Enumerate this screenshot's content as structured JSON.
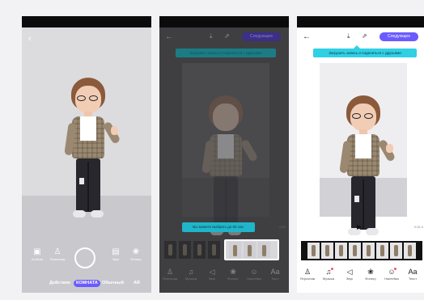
{
  "screen1": {
    "back_icon": "chevron-left-icon",
    "tools": [
      {
        "label": "Альбом",
        "icon": "album-icon"
      },
      {
        "label": "Персонаж",
        "icon": "character-icon"
      },
      {
        "label": "Звук",
        "icon": "sound-icon"
      },
      {
        "label": "Фильтр",
        "icon": "filter-icon"
      }
    ],
    "modes": [
      "Действие",
      "КОМНАТА",
      "Обычный",
      "AR"
    ],
    "active_mode": "КОМНАТА",
    "accent_color": "#6b5bff"
  },
  "screen2": {
    "next_label": "Следующее",
    "banner": "Загрузить запись и поделиться с друзьями",
    "tooltip": "Вы можете выбрать до 60 сек.",
    "side_time": "0:00",
    "bottom": [
      "Персонаж",
      "Музыка",
      "Звук",
      "Фильтр",
      "Наклейка",
      "Текст"
    ]
  },
  "screen3": {
    "next_label": "Следующее",
    "banner": "Загрузить запись и поделиться с друзьями",
    "time": "0:06.3",
    "bottom": [
      "Персонаж",
      "Музыка",
      "Звук",
      "Фильтр",
      "Наклейка",
      "Текст"
    ],
    "banner_color": "#2fd0e4"
  }
}
